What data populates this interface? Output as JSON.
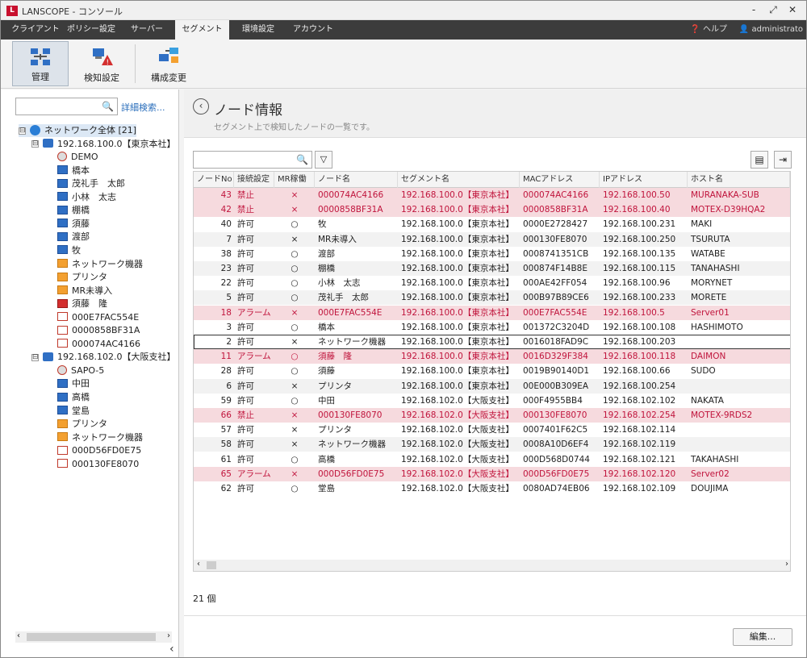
{
  "window": {
    "title": "LANSCOPE - コンソール",
    "app_logo": "L",
    "minimize": "-",
    "restore": "⤢",
    "close": "✕"
  },
  "menu": {
    "tabs": [
      "クライアント",
      "ポリシー設定",
      "サーバー",
      "セグメント",
      "環境設定",
      "アカウント"
    ],
    "active": "セグメント",
    "help": "ヘルプ",
    "user": "administrato"
  },
  "toolbar": {
    "buttons": [
      "管理",
      "検知設定",
      "構成変更"
    ],
    "active": "管理"
  },
  "left": {
    "search_placeholder": "",
    "advanced_search": "詳細検索...",
    "tree": [
      {
        "label": "ネットワーク全体 [21]",
        "icon": "globe-icon",
        "level": 0,
        "expander": "⊟"
      },
      {
        "label": "192.168.100.0【東京本社】",
        "icon": "network-icon",
        "level": 1,
        "expander": "⊟"
      },
      {
        "label": "DEMO",
        "icon": "disconnected-icon",
        "level": 2
      },
      {
        "label": "橋本",
        "icon": "pc-icon",
        "level": 2
      },
      {
        "label": "茂礼手　太郎",
        "icon": "pc-icon",
        "level": 2
      },
      {
        "label": "小林　太志",
        "icon": "pc-icon",
        "level": 2
      },
      {
        "label": "棚橋",
        "icon": "pc-icon",
        "level": 2
      },
      {
        "label": "須藤",
        "icon": "pc-icon",
        "level": 2
      },
      {
        "label": "渡部",
        "icon": "pc-icon",
        "level": 2
      },
      {
        "label": "牧",
        "icon": "pc-icon",
        "level": 2
      },
      {
        "label": "ネットワーク機器",
        "icon": "device-icon",
        "level": 2
      },
      {
        "label": "プリンタ",
        "icon": "device-icon",
        "level": 2
      },
      {
        "label": "MR未導入",
        "icon": "device-icon",
        "level": 2
      },
      {
        "label": "須藤　隆",
        "icon": "alarm-pc-icon",
        "level": 2
      },
      {
        "label": "000E7FAC554E",
        "icon": "blocked-icon",
        "level": 2
      },
      {
        "label": "0000858BF31A",
        "icon": "blocked-icon",
        "level": 2
      },
      {
        "label": "000074AC4166",
        "icon": "blocked-icon",
        "level": 2
      },
      {
        "label": "192.168.102.0【大阪支社】",
        "icon": "network-icon",
        "level": 1,
        "expander": "⊟"
      },
      {
        "label": "SAPO-5",
        "icon": "disconnected-icon",
        "level": 2
      },
      {
        "label": "中田",
        "icon": "pc-icon",
        "level": 2
      },
      {
        "label": "高橋",
        "icon": "pc-icon",
        "level": 2
      },
      {
        "label": "堂島",
        "icon": "pc-icon",
        "level": 2
      },
      {
        "label": "プリンタ",
        "icon": "device-icon",
        "level": 2
      },
      {
        "label": "ネットワーク機器",
        "icon": "device-icon",
        "level": 2
      },
      {
        "label": "000D56FD0E75",
        "icon": "blocked-icon",
        "level": 2
      },
      {
        "label": "000130FE8070",
        "icon": "blocked-icon",
        "level": 2
      }
    ],
    "scroll_left": "‹",
    "scroll_right": "›",
    "collapse": "‹"
  },
  "main": {
    "back_arrow": "‹",
    "title": "ノード情報",
    "subtitle": "セグメント上で検知したノードの一覧です。",
    "search_placeholder": "",
    "columns": [
      "ノードNo",
      "接続設定",
      "MR稼働",
      "ノード名",
      "セグメント名",
      "MACアドレス",
      "IPアドレス",
      "ホスト名"
    ],
    "rows": [
      {
        "no": "43",
        "conn": "禁止",
        "mr": "×",
        "name": "000074AC4166",
        "seg": "192.168.100.0【東京本社】",
        "mac": "000074AC4166",
        "ip": "192.168.100.50",
        "host": "MURANAKA-SUB",
        "state": "warn"
      },
      {
        "no": "42",
        "conn": "禁止",
        "mr": "×",
        "name": "0000858BF31A",
        "seg": "192.168.100.0【東京本社】",
        "mac": "0000858BF31A",
        "ip": "192.168.100.40",
        "host": "MOTEX-D39HQA2",
        "state": "warn"
      },
      {
        "no": "40",
        "conn": "許可",
        "mr": "○",
        "name": "牧",
        "seg": "192.168.100.0【東京本社】",
        "mac": "0000E2728427",
        "ip": "192.168.100.231",
        "host": "MAKI",
        "state": ""
      },
      {
        "no": "7",
        "conn": "許可",
        "mr": "×",
        "name": "MR未導入",
        "seg": "192.168.100.0【東京本社】",
        "mac": "000130FE8070",
        "ip": "192.168.100.250",
        "host": "TSURUTA",
        "state": "alt"
      },
      {
        "no": "38",
        "conn": "許可",
        "mr": "○",
        "name": "渡部",
        "seg": "192.168.100.0【東京本社】",
        "mac": "0008741351CB",
        "ip": "192.168.100.135",
        "host": "WATABE",
        "state": ""
      },
      {
        "no": "23",
        "conn": "許可",
        "mr": "○",
        "name": "棚橋",
        "seg": "192.168.100.0【東京本社】",
        "mac": "000874F14B8E",
        "ip": "192.168.100.115",
        "host": "TANAHASHI",
        "state": "alt"
      },
      {
        "no": "22",
        "conn": "許可",
        "mr": "○",
        "name": "小林　太志",
        "seg": "192.168.100.0【東京本社】",
        "mac": "000AE42FF054",
        "ip": "192.168.100.96",
        "host": "MORYNET",
        "state": ""
      },
      {
        "no": "5",
        "conn": "許可",
        "mr": "○",
        "name": "茂礼手　太郎",
        "seg": "192.168.100.0【東京本社】",
        "mac": "000B97B89CE6",
        "ip": "192.168.100.233",
        "host": "MORETE",
        "state": "alt"
      },
      {
        "no": "18",
        "conn": "アラーム",
        "mr": "×",
        "name": "000E7FAC554E",
        "seg": "192.168.100.0【東京本社】",
        "mac": "000E7FAC554E",
        "ip": "192.168.100.5",
        "host": "Server01",
        "state": "warn"
      },
      {
        "no": "3",
        "conn": "許可",
        "mr": "○",
        "name": "橋本",
        "seg": "192.168.100.0【東京本社】",
        "mac": "001372C3204D",
        "ip": "192.168.100.108",
        "host": "HASHIMOTO",
        "state": ""
      },
      {
        "no": "2",
        "conn": "許可",
        "mr": "×",
        "name": "ネットワーク機器",
        "seg": "192.168.100.0【東京本社】",
        "mac": "0016018FAD9C",
        "ip": "192.168.100.203",
        "host": "",
        "state": "focus"
      },
      {
        "no": "11",
        "conn": "アラーム",
        "mr": "○",
        "name": "須藤　隆",
        "seg": "192.168.100.0【東京本社】",
        "mac": "0016D329F384",
        "ip": "192.168.100.118",
        "host": "DAIMON",
        "state": "warn"
      },
      {
        "no": "28",
        "conn": "許可",
        "mr": "○",
        "name": "須藤",
        "seg": "192.168.100.0【東京本社】",
        "mac": "0019B90140D1",
        "ip": "192.168.100.66",
        "host": "SUDO",
        "state": ""
      },
      {
        "no": "6",
        "conn": "許可",
        "mr": "×",
        "name": "プリンタ",
        "seg": "192.168.100.0【東京本社】",
        "mac": "00E000B309EA",
        "ip": "192.168.100.254",
        "host": "",
        "state": "alt"
      },
      {
        "no": "59",
        "conn": "許可",
        "mr": "○",
        "name": "中田",
        "seg": "192.168.102.0【大阪支社】",
        "mac": "000F4955BB4",
        "ip": "192.168.102.102",
        "host": "NAKATA",
        "state": ""
      },
      {
        "no": "66",
        "conn": "禁止",
        "mr": "×",
        "name": "000130FE8070",
        "seg": "192.168.102.0【大阪支社】",
        "mac": "000130FE8070",
        "ip": "192.168.102.254",
        "host": "MOTEX-9RDS2",
        "state": "warn"
      },
      {
        "no": "57",
        "conn": "許可",
        "mr": "×",
        "name": "プリンタ",
        "seg": "192.168.102.0【大阪支社】",
        "mac": "0007401F62C5",
        "ip": "192.168.102.114",
        "host": "",
        "state": ""
      },
      {
        "no": "58",
        "conn": "許可",
        "mr": "×",
        "name": "ネットワーク機器",
        "seg": "192.168.102.0【大阪支社】",
        "mac": "0008A10D6EF4",
        "ip": "192.168.102.119",
        "host": "",
        "state": "alt"
      },
      {
        "no": "61",
        "conn": "許可",
        "mr": "○",
        "name": "高橋",
        "seg": "192.168.102.0【大阪支社】",
        "mac": "000D568D0744",
        "ip": "192.168.102.121",
        "host": "TAKAHASHI",
        "state": ""
      },
      {
        "no": "65",
        "conn": "アラーム",
        "mr": "×",
        "name": "000D56FD0E75",
        "seg": "192.168.102.0【大阪支社】",
        "mac": "000D56FD0E75",
        "ip": "192.168.102.120",
        "host": "Server02",
        "state": "warn"
      },
      {
        "no": "62",
        "conn": "許可",
        "mr": "○",
        "name": "堂島",
        "seg": "192.168.102.0【大阪支社】",
        "mac": "0080AD74EB06",
        "ip": "192.168.102.109",
        "host": "DOUJIMA",
        "state": ""
      }
    ],
    "count": "21 個",
    "scroll_left": "‹",
    "scroll_right": "›",
    "edit_button": "編集..."
  },
  "colors": {
    "warn_bg": "#f6dade",
    "warn_text": "#c0143c",
    "menu_bg": "#3c3c3c",
    "link": "#2a6ebb"
  }
}
